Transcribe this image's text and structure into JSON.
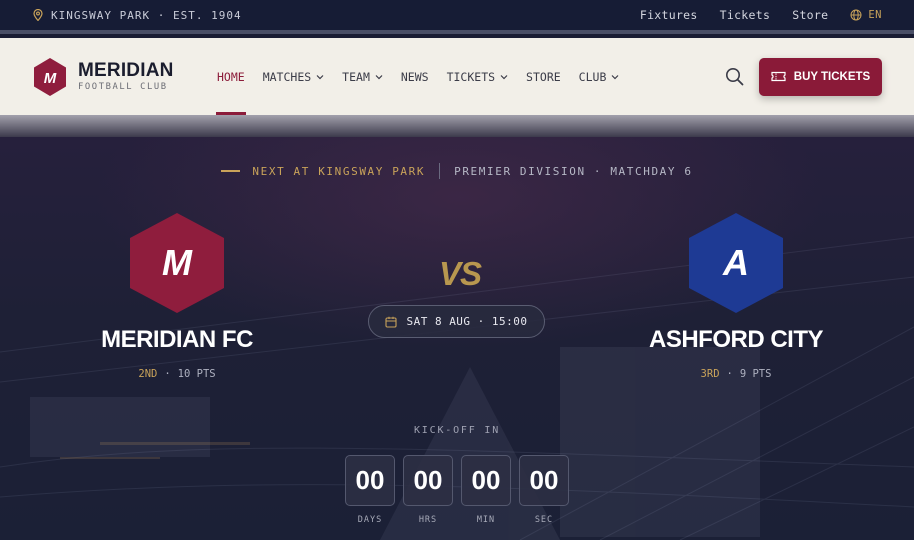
{
  "topbar": {
    "location": "KINGSWAY PARK · EST. 1904",
    "links": [
      "Fixtures",
      "Tickets",
      "Store"
    ],
    "language": "EN"
  },
  "brand": {
    "monogram": "M",
    "name": "MERIDIAN",
    "subtitle": "FOOTBALL CLUB"
  },
  "nav": {
    "items": [
      {
        "label": "HOME",
        "active": true,
        "dropdown": false
      },
      {
        "label": "MATCHES",
        "active": false,
        "dropdown": true
      },
      {
        "label": "TEAM",
        "active": false,
        "dropdown": true
      },
      {
        "label": "NEWS",
        "active": false,
        "dropdown": false
      },
      {
        "label": "TICKETS",
        "active": false,
        "dropdown": true
      },
      {
        "label": "STORE",
        "active": false,
        "dropdown": false
      },
      {
        "label": "CLUB",
        "active": false,
        "dropdown": true
      }
    ],
    "buy_label": "BUY TICKETS"
  },
  "match": {
    "eyebrow_venue": "NEXT AT KINGSWAY PARK",
    "eyebrow_division": "PREMIER DIVISION · MATCHDAY 6",
    "vs": "VS",
    "date": "SAT 8 AUG · 15:00",
    "home": {
      "initial": "M",
      "name": "MERIDIAN FC",
      "rank": "2ND",
      "points": "10 PTS",
      "color": "#8f1d3d"
    },
    "away": {
      "initial": "A",
      "name": "ASHFORD CITY",
      "rank": "3RD",
      "points": "9 PTS",
      "color": "#1e3a94"
    }
  },
  "countdown": {
    "label": "KICK-OFF IN",
    "units": [
      {
        "value": "00",
        "label": "DAYS"
      },
      {
        "value": "00",
        "label": "HRS"
      },
      {
        "value": "00",
        "label": "MIN"
      },
      {
        "value": "00",
        "label": "SEC"
      }
    ]
  },
  "colors": {
    "accent": "#8a1a38",
    "gold": "#c9a35a",
    "navy": "#161c35",
    "header_bg": "#f2efe8"
  }
}
